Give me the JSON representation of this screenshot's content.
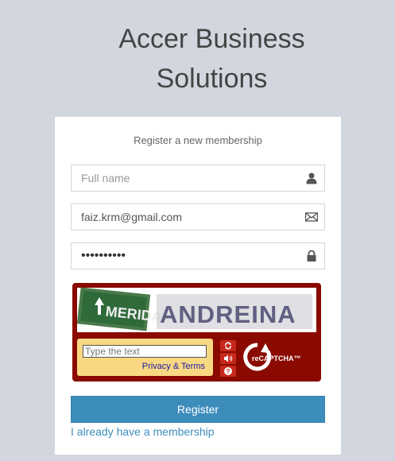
{
  "logo": {
    "line1": "Accer Business",
    "line2": "Solutions"
  },
  "form": {
    "message": "Register a new membership",
    "fullname": {
      "placeholder": "Full name",
      "value": "",
      "icon": "user-icon"
    },
    "email": {
      "value": "faiz.krm@gmail.com",
      "icon": "envelope-icon"
    },
    "password": {
      "value": "••••••••••",
      "icon": "lock-icon"
    },
    "register_label": "Register",
    "login_link": "I already have a membership"
  },
  "captcha": {
    "words": [
      "MERIDA",
      "ANDREINA"
    ],
    "input_placeholder": "Type the text",
    "privacy_link": "Privacy & Terms",
    "brand": "reCAPTCHA™",
    "brand_colors": {
      "frame": "#8a0a00",
      "input_bg": "#f8d882",
      "button": "#c7281b"
    },
    "buttons": [
      "refresh-icon",
      "audio-icon",
      "help-icon"
    ]
  },
  "colors": {
    "background": "#d2d6de",
    "primary": "#3c8dbc"
  }
}
